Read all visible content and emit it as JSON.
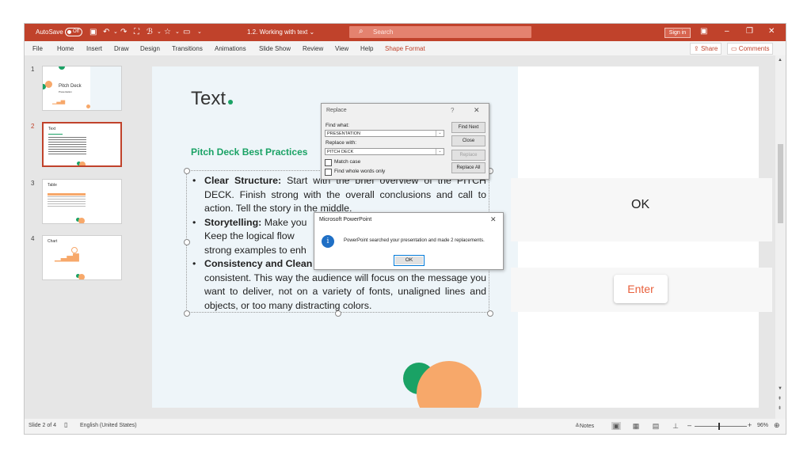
{
  "titlebar": {
    "autosave": "AutoSave",
    "autosave_state": "Off",
    "doc_title": "1.2. Working with text",
    "search_placeholder": "Search",
    "sign_in": "Sign in"
  },
  "menu": {
    "items": [
      "File",
      "Home",
      "Insert",
      "Draw",
      "Design",
      "Transitions",
      "Animations",
      "Slide Show",
      "Review",
      "View",
      "Help",
      "Shape Format"
    ],
    "share": "Share",
    "comments": "Comments"
  },
  "thumbnails": [
    {
      "num": "1",
      "title": "Pitch Deck",
      "sub": "Presentation"
    },
    {
      "num": "2",
      "title": "Text"
    },
    {
      "num": "3",
      "title": "Table"
    },
    {
      "num": "4",
      "title": "Chart"
    }
  ],
  "slide": {
    "title": "Text",
    "subtitle": "Pitch Deck Best Practices",
    "bullet1_bold": "Clear Structure:",
    "bullet1_text": " Start with the brief overview of the PITCH DECK. Finish strong with the overall conclusions and call to action. Tell the story in the middle.",
    "bullet2_bold": "Storytelling:",
    "bullet2_text": " Make you",
    "bullet2_line2": "Keep the logical flow",
    "bullet2_line3": "strong examples to enh",
    "bullet3_bold": "Consistency and Clean",
    "bullet3_rest": "consistent. This way the audience will focus on the message you want to deliver, not on a variety of fonts, unaligned lines and objects, or too many distracting colors."
  },
  "overlay": {
    "ok_label": "OK",
    "enter_label": "Enter"
  },
  "replace_dialog": {
    "title": "Replace",
    "help": "?",
    "find_label": "Find what:",
    "find_value": "PRESENTATION",
    "replace_label": "Replace with:",
    "replace_value": "PITCH DECK",
    "match_case": "Match case",
    "whole_words": "Find whole words only",
    "find_next": "Find Next",
    "close": "Close",
    "replace": "Replace",
    "replace_all": "Replace All"
  },
  "message_box": {
    "title": "Microsoft PowerPoint",
    "message": "PowerPoint searched your presentation and made 2 replacements.",
    "ok": "OK"
  },
  "status": {
    "slide_info": "Slide 2 of 4",
    "language": "English (United States)",
    "notes": "Notes",
    "zoom": "96%"
  },
  "colors": {
    "accent": "#c0422b",
    "green": "#1aa265",
    "orange": "#f7a86a",
    "enter_text": "#e8603c"
  }
}
